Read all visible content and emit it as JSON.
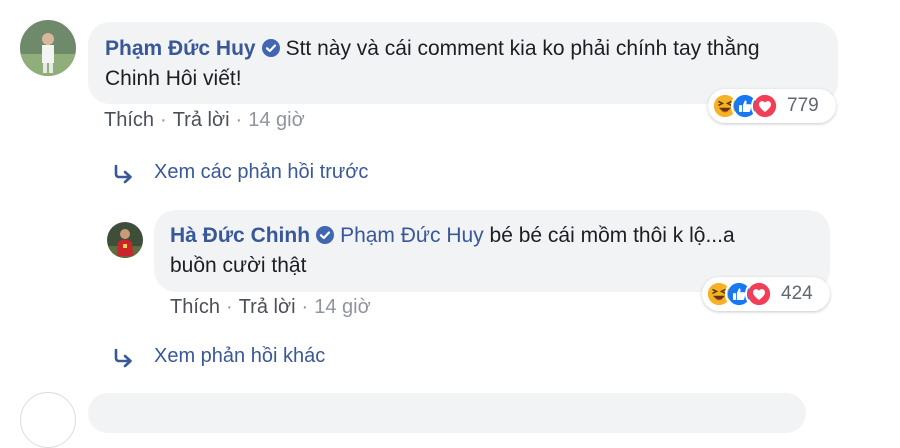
{
  "comments": [
    {
      "author": "Phạm Đức Huy",
      "text": "Stt này và cái comment kia ko phải chính tay thằng Chinh Hôi viết!",
      "text_line1": "Stt này và cái comment kia ko phải chính tay thằng",
      "text_line2": "Chinh Hôi viết!",
      "like_label": "Thích",
      "reply_label": "Trả lời",
      "time": "14 giờ",
      "reaction_count": "779",
      "reactions": [
        "haha-icon",
        "like-icon",
        "love-icon"
      ]
    },
    {
      "author": "Hà Đức Chinh",
      "mention": "Phạm Đức Huy",
      "text": "bé bé cái mồm thôi k lộ...a buồn cười thật",
      "text_line1": "bé bé cái mồm thôi k lộ...a",
      "text_line2": "buồn cười thật",
      "like_label": "Thích",
      "reply_label": "Trả lời",
      "time": "14 giờ",
      "reaction_count": "424",
      "reactions": [
        "haha-icon",
        "like-icon",
        "love-icon"
      ]
    }
  ],
  "links": {
    "view_previous_replies": "Xem các phản hồi trước",
    "view_more_replies": "Xem phản hồi khác"
  },
  "separator": "·",
  "colors": {
    "link": "#385898",
    "bubble": "#f2f3f5",
    "meta": "#90949c",
    "haha": "#f7b125",
    "like": "#1877f2",
    "love": "#f33e58"
  }
}
